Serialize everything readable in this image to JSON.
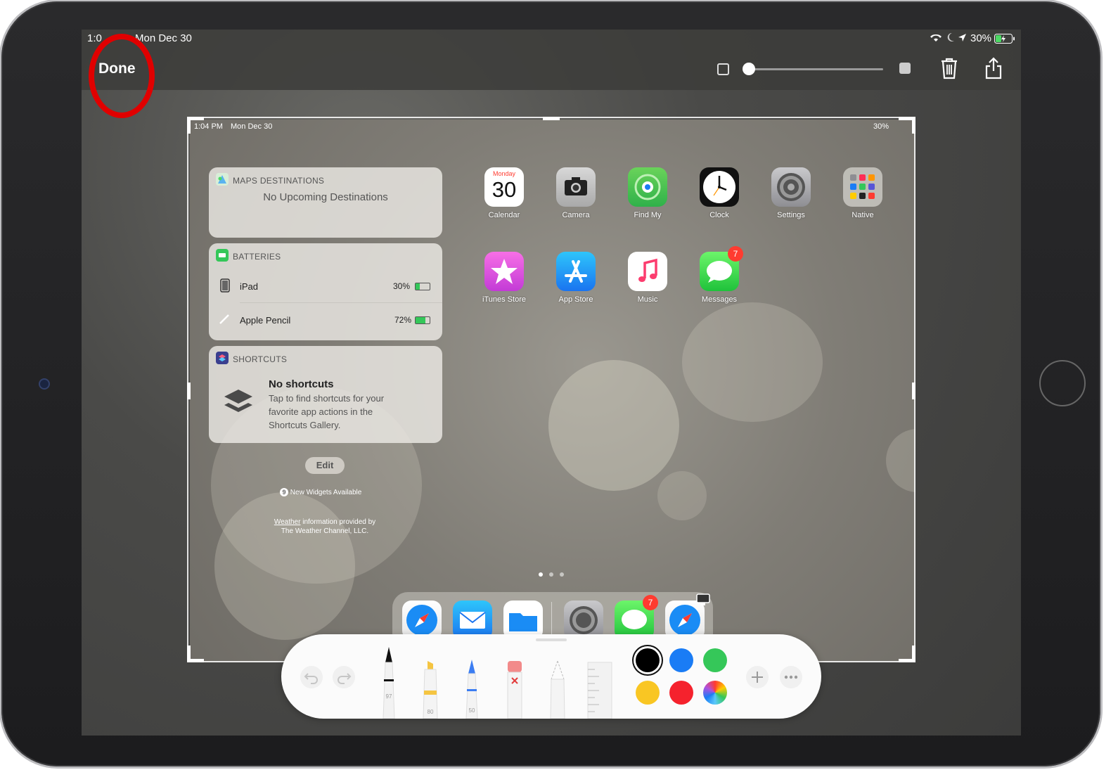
{
  "status_bar": {
    "time": "1:0",
    "date": "Mon Dec 30",
    "battery": "30%"
  },
  "toolbar": {
    "done_label": "Done"
  },
  "screenshot": {
    "status_bar": {
      "time": "1:04 PM",
      "date": "Mon Dec 30",
      "battery": "30%"
    },
    "widgets": {
      "maps": {
        "title": "MAPS DESTINATIONS",
        "body": "No Upcoming Destinations"
      },
      "batteries": {
        "title": "BATTERIES",
        "items": [
          {
            "name": "iPad",
            "percent": "30%",
            "level": 0.3
          },
          {
            "name": "Apple Pencil",
            "percent": "72%",
            "level": 0.72
          }
        ]
      },
      "shortcuts": {
        "title": "SHORTCUTS",
        "heading": "No shortcuts",
        "body_line1": "Tap to find shortcuts for your",
        "body_line2": "favorite app actions in the",
        "body_line3": "Shortcuts Gallery."
      },
      "edit_label": "Edit",
      "new_widgets_count": "9",
      "new_widgets_label": "New Widgets Available",
      "weather_link": "Weather",
      "weather_line1_rest": " information provided by",
      "weather_line2": "The Weather Channel, LLC."
    },
    "calendar": {
      "day_name": "Monday",
      "day_number": "30"
    },
    "apps": [
      {
        "label": "Calendar"
      },
      {
        "label": "Camera"
      },
      {
        "label": "Find My"
      },
      {
        "label": "Clock"
      },
      {
        "label": "Settings"
      },
      {
        "label": "Native"
      },
      {
        "label": "iTunes Store"
      },
      {
        "label": "App Store"
      },
      {
        "label": "Music"
      },
      {
        "label": "Messages",
        "badge": "7"
      }
    ],
    "dock_badge": "7",
    "page_count": 3,
    "active_page": 1
  },
  "palette": {
    "tool_sizes": {
      "pen": "97",
      "marker": "80",
      "pencil": "50"
    },
    "colors": [
      "#000000",
      "#1a7cf5",
      "#35c759",
      "#f9c623",
      "#f5222d"
    ]
  }
}
